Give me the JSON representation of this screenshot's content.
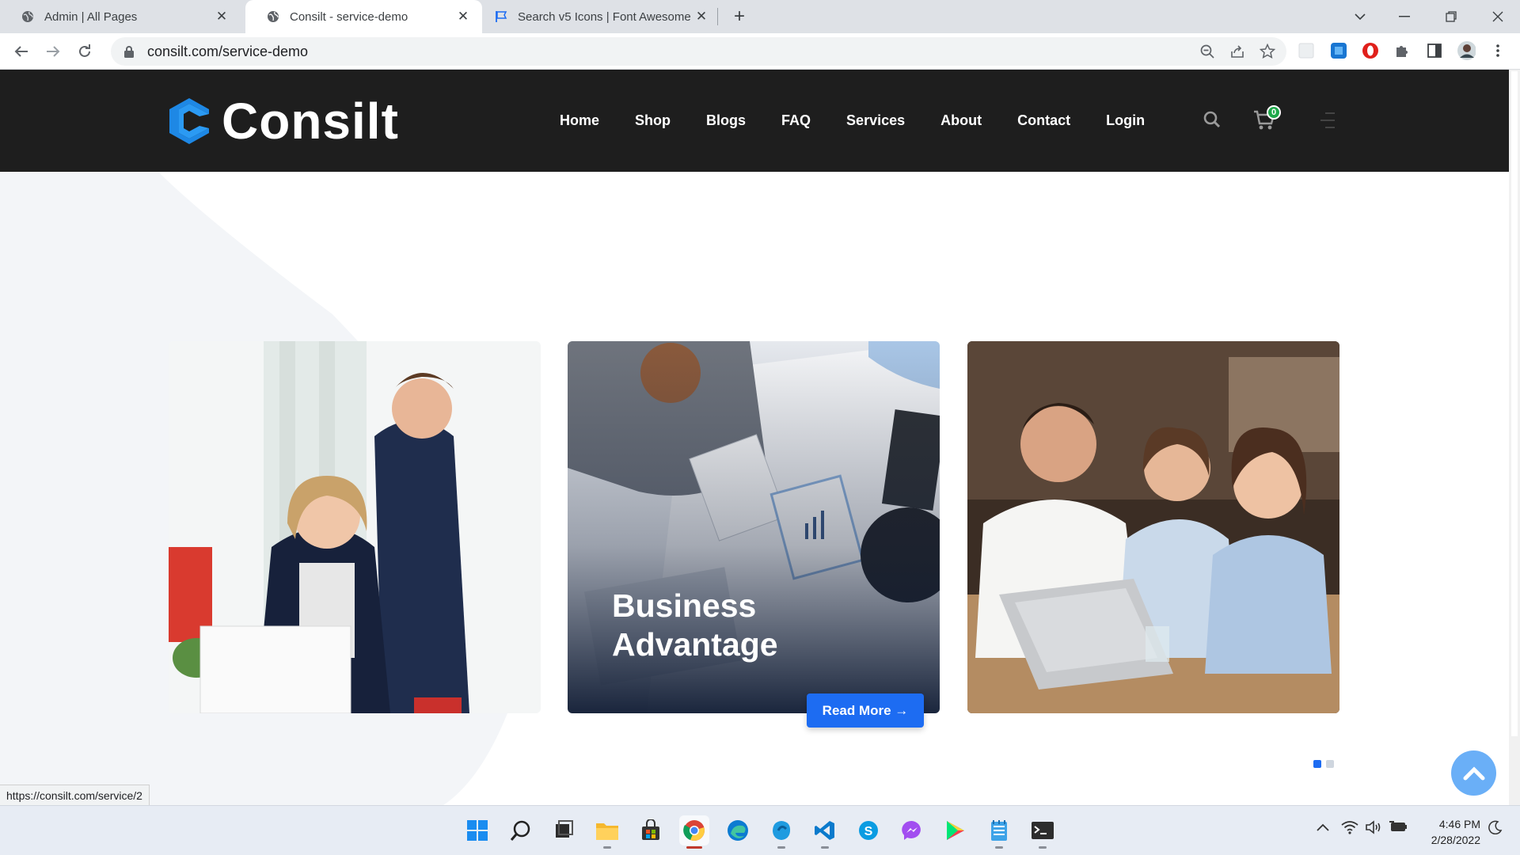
{
  "browser": {
    "tabs": [
      {
        "title": "Admin | All Pages",
        "active": false
      },
      {
        "title": "Consilt - service-demo",
        "active": true
      },
      {
        "title": "Search v5 Icons | Font Awesome",
        "active": false
      }
    ],
    "url": "consilt.com/service-demo",
    "status_url": "https://consilt.com/service/2"
  },
  "site": {
    "logo_text": "Consilt",
    "nav": [
      "Home",
      "Shop",
      "Blogs",
      "FAQ",
      "Services",
      "About",
      "Contact",
      "Login"
    ],
    "cart_count": "0",
    "accent": "#1d6cf2"
  },
  "slider": {
    "cards": [
      {
        "image": "office-woman-laptop-man-photo",
        "title": ""
      },
      {
        "image": "business-meeting-overhead-photo",
        "title_line1": "Business",
        "title_line2": "Advantage",
        "button": "Read More →"
      },
      {
        "image": "team-laptop-discussion-photo",
        "title": ""
      }
    ],
    "active_dot": 1,
    "dot_count": 2
  },
  "taskbar": {
    "time": "4:46 PM",
    "date": "2/28/2022",
    "apps": [
      "start-icon",
      "search-icon",
      "task-view-icon",
      "file-explorer-icon",
      "store-icon",
      "chrome-icon",
      "edge-icon",
      "app-icon",
      "vscode-icon",
      "skype-icon",
      "messenger-icon",
      "play-store-icon",
      "notepad-icon",
      "terminal-icon"
    ]
  }
}
